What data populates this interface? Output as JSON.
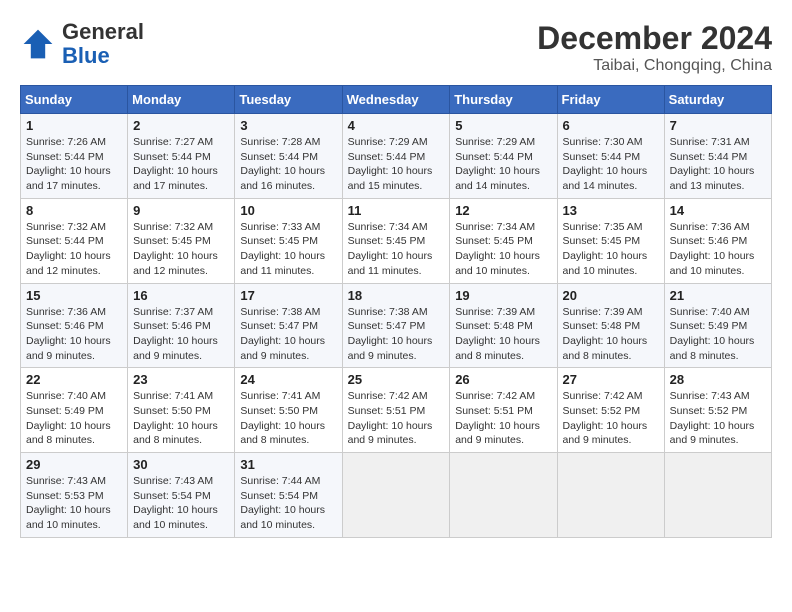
{
  "header": {
    "logo_general": "General",
    "logo_blue": "Blue",
    "month_year": "December 2024",
    "location": "Taibai, Chongqing, China"
  },
  "weekdays": [
    "Sunday",
    "Monday",
    "Tuesday",
    "Wednesday",
    "Thursday",
    "Friday",
    "Saturday"
  ],
  "weeks": [
    [
      {
        "day": "1",
        "sunrise": "7:26 AM",
        "sunset": "5:44 PM",
        "daylight": "10 hours and 17 minutes."
      },
      {
        "day": "2",
        "sunrise": "7:27 AM",
        "sunset": "5:44 PM",
        "daylight": "10 hours and 17 minutes."
      },
      {
        "day": "3",
        "sunrise": "7:28 AM",
        "sunset": "5:44 PM",
        "daylight": "10 hours and 16 minutes."
      },
      {
        "day": "4",
        "sunrise": "7:29 AM",
        "sunset": "5:44 PM",
        "daylight": "10 hours and 15 minutes."
      },
      {
        "day": "5",
        "sunrise": "7:29 AM",
        "sunset": "5:44 PM",
        "daylight": "10 hours and 14 minutes."
      },
      {
        "day": "6",
        "sunrise": "7:30 AM",
        "sunset": "5:44 PM",
        "daylight": "10 hours and 14 minutes."
      },
      {
        "day": "7",
        "sunrise": "7:31 AM",
        "sunset": "5:44 PM",
        "daylight": "10 hours and 13 minutes."
      }
    ],
    [
      {
        "day": "8",
        "sunrise": "7:32 AM",
        "sunset": "5:44 PM",
        "daylight": "10 hours and 12 minutes."
      },
      {
        "day": "9",
        "sunrise": "7:32 AM",
        "sunset": "5:45 PM",
        "daylight": "10 hours and 12 minutes."
      },
      {
        "day": "10",
        "sunrise": "7:33 AM",
        "sunset": "5:45 PM",
        "daylight": "10 hours and 11 minutes."
      },
      {
        "day": "11",
        "sunrise": "7:34 AM",
        "sunset": "5:45 PM",
        "daylight": "10 hours and 11 minutes."
      },
      {
        "day": "12",
        "sunrise": "7:34 AM",
        "sunset": "5:45 PM",
        "daylight": "10 hours and 10 minutes."
      },
      {
        "day": "13",
        "sunrise": "7:35 AM",
        "sunset": "5:45 PM",
        "daylight": "10 hours and 10 minutes."
      },
      {
        "day": "14",
        "sunrise": "7:36 AM",
        "sunset": "5:46 PM",
        "daylight": "10 hours and 10 minutes."
      }
    ],
    [
      {
        "day": "15",
        "sunrise": "7:36 AM",
        "sunset": "5:46 PM",
        "daylight": "10 hours and 9 minutes."
      },
      {
        "day": "16",
        "sunrise": "7:37 AM",
        "sunset": "5:46 PM",
        "daylight": "10 hours and 9 minutes."
      },
      {
        "day": "17",
        "sunrise": "7:38 AM",
        "sunset": "5:47 PM",
        "daylight": "10 hours and 9 minutes."
      },
      {
        "day": "18",
        "sunrise": "7:38 AM",
        "sunset": "5:47 PM",
        "daylight": "10 hours and 9 minutes."
      },
      {
        "day": "19",
        "sunrise": "7:39 AM",
        "sunset": "5:48 PM",
        "daylight": "10 hours and 8 minutes."
      },
      {
        "day": "20",
        "sunrise": "7:39 AM",
        "sunset": "5:48 PM",
        "daylight": "10 hours and 8 minutes."
      },
      {
        "day": "21",
        "sunrise": "7:40 AM",
        "sunset": "5:49 PM",
        "daylight": "10 hours and 8 minutes."
      }
    ],
    [
      {
        "day": "22",
        "sunrise": "7:40 AM",
        "sunset": "5:49 PM",
        "daylight": "10 hours and 8 minutes."
      },
      {
        "day": "23",
        "sunrise": "7:41 AM",
        "sunset": "5:50 PM",
        "daylight": "10 hours and 8 minutes."
      },
      {
        "day": "24",
        "sunrise": "7:41 AM",
        "sunset": "5:50 PM",
        "daylight": "10 hours and 8 minutes."
      },
      {
        "day": "25",
        "sunrise": "7:42 AM",
        "sunset": "5:51 PM",
        "daylight": "10 hours and 9 minutes."
      },
      {
        "day": "26",
        "sunrise": "7:42 AM",
        "sunset": "5:51 PM",
        "daylight": "10 hours and 9 minutes."
      },
      {
        "day": "27",
        "sunrise": "7:42 AM",
        "sunset": "5:52 PM",
        "daylight": "10 hours and 9 minutes."
      },
      {
        "day": "28",
        "sunrise": "7:43 AM",
        "sunset": "5:52 PM",
        "daylight": "10 hours and 9 minutes."
      }
    ],
    [
      {
        "day": "29",
        "sunrise": "7:43 AM",
        "sunset": "5:53 PM",
        "daylight": "10 hours and 10 minutes."
      },
      {
        "day": "30",
        "sunrise": "7:43 AM",
        "sunset": "5:54 PM",
        "daylight": "10 hours and 10 minutes."
      },
      {
        "day": "31",
        "sunrise": "7:44 AM",
        "sunset": "5:54 PM",
        "daylight": "10 hours and 10 minutes."
      },
      null,
      null,
      null,
      null
    ]
  ]
}
